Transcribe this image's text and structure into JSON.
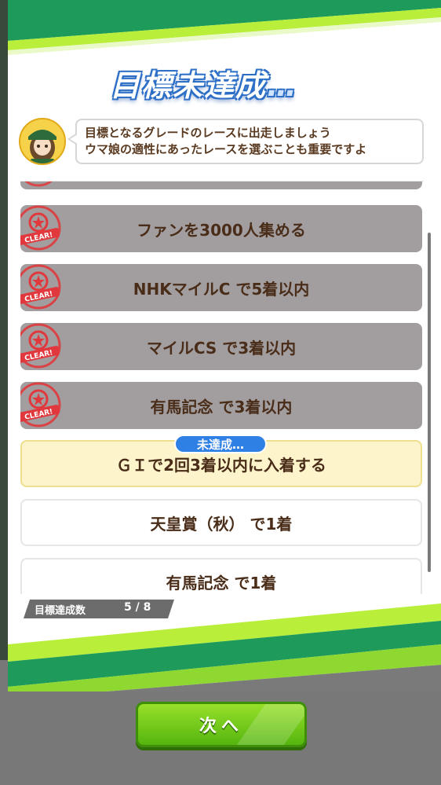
{
  "title": {
    "main": "目標未達成",
    "dots": "…"
  },
  "speech": {
    "line1": "目標となるグレードのレースに出走しましょう",
    "line2": "ウマ娘の適性にあったレースを選ぶことも重要ですよ"
  },
  "stamp_text": "CLEAR!",
  "objectives": [
    {
      "label": "ファンを3000人集める",
      "status": "cleared"
    },
    {
      "label": "NHKマイルC で5着以内",
      "status": "cleared"
    },
    {
      "label": "マイルCS で3着以内",
      "status": "cleared"
    },
    {
      "label": "有馬記念 で3着以内",
      "status": "cleared"
    },
    {
      "label": "ＧＩで2回3着以内に入着する",
      "status": "active"
    },
    {
      "label": "天皇賞（秋） で1着",
      "status": "pending"
    },
    {
      "label": "有馬記念 で1着",
      "status": "pending"
    }
  ],
  "current_badge": "未達成…",
  "progress": {
    "label": "目標達成数",
    "value": "5 / 8",
    "achieved": 5,
    "total": 8
  },
  "next_button": "次へ",
  "colors": {
    "accent_green": "#79c51b",
    "cleared_gray": "#a29e9f",
    "active_yellow": "#fdf4cc",
    "badge_blue": "#2f80e4",
    "stamp_red": "#e0383c"
  }
}
